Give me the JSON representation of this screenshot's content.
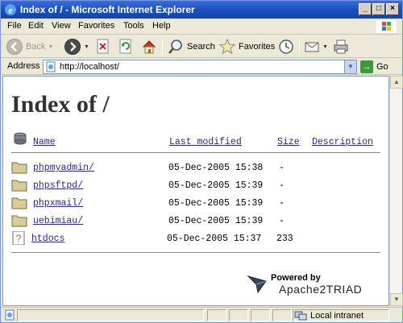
{
  "window": {
    "title": "Index of / - Microsoft Internet Explorer",
    "controls": {
      "minimize": "_",
      "maximize": "□",
      "close": "×"
    }
  },
  "menu": {
    "items": [
      "File",
      "Edit",
      "View",
      "Favorites",
      "Tools",
      "Help"
    ]
  },
  "toolbar": {
    "back_label": "Back",
    "search_label": "Search",
    "favorites_label": "Favorites"
  },
  "address": {
    "label": "Address",
    "url": "http://localhost/",
    "go_label": "Go"
  },
  "page": {
    "heading": "Index of /",
    "columns": {
      "name": "Name",
      "modified": "Last modified",
      "size": "Size",
      "description": "Description"
    },
    "entries": [
      {
        "name": "phpmyadmin/",
        "modified": "05-Dec-2005 15:38",
        "size": "-",
        "icon": "folder-icon"
      },
      {
        "name": "phpsftpd/",
        "modified": "05-Dec-2005 15:39",
        "size": "-",
        "icon": "folder-icon"
      },
      {
        "name": "phpxmail/",
        "modified": "05-Dec-2005 15:39",
        "size": "-",
        "icon": "folder-icon"
      },
      {
        "name": "uebimiau/",
        "modified": "05-Dec-2005 15:39",
        "size": "-",
        "icon": "folder-icon"
      },
      {
        "name": "htdocs",
        "modified": "05-Dec-2005 15:37",
        "size": "233",
        "icon": "unknown-file-icon"
      }
    ],
    "powered_by": "Powered by",
    "brand": "Apache2TRIAD"
  },
  "status": {
    "zone": "Local intranet"
  },
  "colors": {
    "title_bar": "#1c4fbf",
    "link": "#2a2a80",
    "content_bg": "#ffffff"
  }
}
